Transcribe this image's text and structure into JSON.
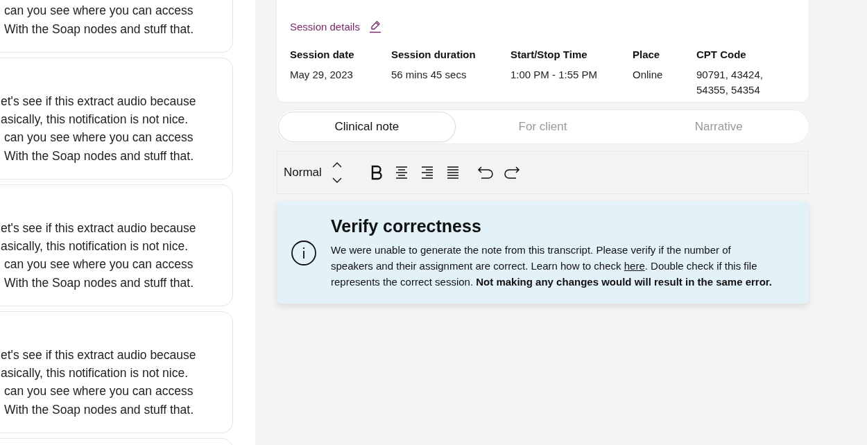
{
  "transcript_cards": [
    {
      "lines": [
        "can you see where you can access",
        "With the Soap nodes and stuff that."
      ]
    },
    {
      "lines": [
        "et's see if this extract audio because",
        "asically, this notification is not nice.",
        "can you see where you can access",
        "With the Soap nodes and stuff that."
      ]
    },
    {
      "lines": [
        "et's see if this extract audio because",
        "asically, this notification is not nice.",
        "can you see where you can access",
        "With the Soap nodes and stuff that."
      ]
    },
    {
      "lines": [
        "et's see if this extract audio because",
        "asically, this notification is not nice.",
        "can you see where you can access",
        "With the Soap nodes and stuff that."
      ]
    }
  ],
  "session": {
    "title": "Session details",
    "fields": [
      {
        "label": "Session date",
        "value": "May 29, 2023"
      },
      {
        "label": "Session duration",
        "value": "56 mins 45 secs"
      },
      {
        "label": "Start/Stop Time",
        "value": "1:00 PM - 1:55 PM"
      },
      {
        "label": "Place",
        "value": "Online"
      },
      {
        "label": "CPT Code",
        "value": "90791, 43424, 54355, 54354"
      }
    ]
  },
  "tabs": [
    {
      "label": "Clinical note",
      "selected": true
    },
    {
      "label": "For client",
      "selected": false
    },
    {
      "label": "Narrative",
      "selected": false
    }
  ],
  "toolbar": {
    "text_style": "Normal"
  },
  "alert": {
    "title": "Verify correctness",
    "body_before": "We were unable to generate the note from this transcript. Please verify if the number of speakers and their assignment are correct. Learn how to check ",
    "link": "here",
    "body_after": ". Double check if this file represents the correct session. **Not making any changes would will result in the same error.**"
  }
}
